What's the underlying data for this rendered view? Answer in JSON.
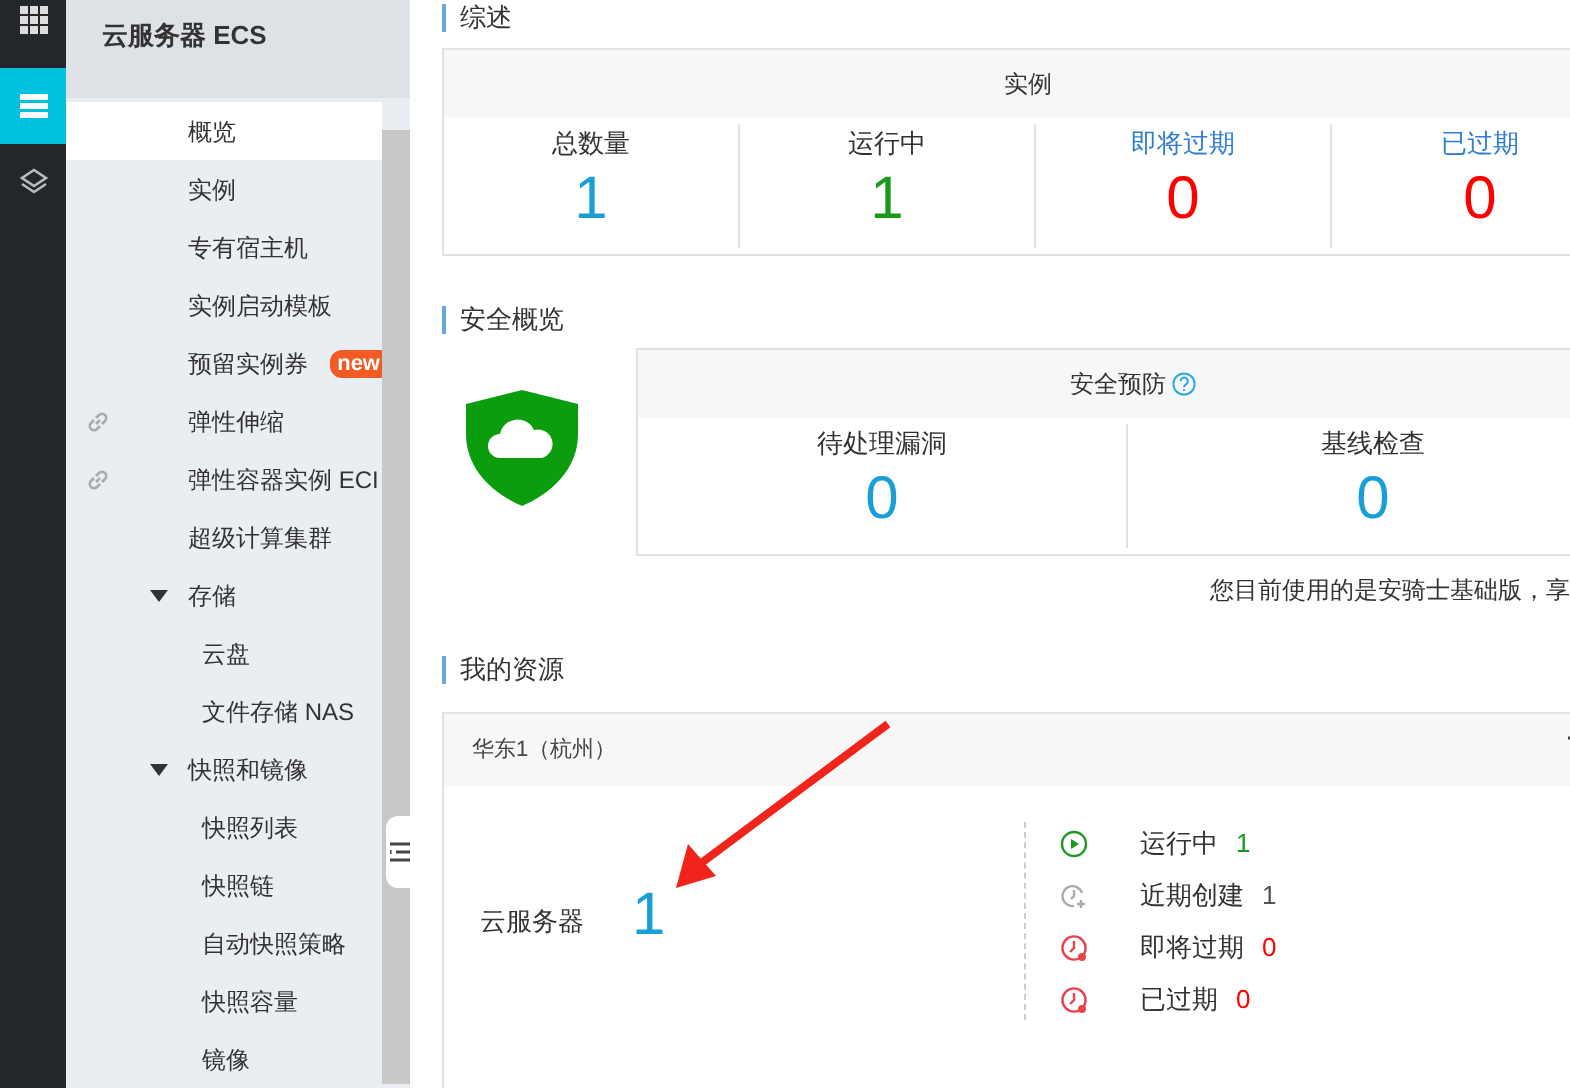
{
  "sidebar": {
    "title": "云服务器 ECS",
    "items": [
      {
        "kind": "item",
        "label": "概览",
        "selected": true
      },
      {
        "kind": "item",
        "label": "实例",
        "selected": false
      },
      {
        "kind": "item",
        "label": "专有宿主机",
        "selected": false
      },
      {
        "kind": "item",
        "label": "实例启动模板",
        "selected": false
      },
      {
        "kind": "item",
        "label": "预留实例券",
        "selected": false,
        "badge": "new"
      },
      {
        "kind": "link",
        "label": "弹性伸缩",
        "selected": false
      },
      {
        "kind": "link",
        "label": "弹性容器实例 ECI",
        "selected": false
      },
      {
        "kind": "item",
        "label": "超级计算集群",
        "selected": false
      },
      {
        "kind": "group",
        "label": "存储",
        "expanded": true,
        "children": [
          {
            "kind": "item",
            "label": "云盘",
            "selected": false
          },
          {
            "kind": "item",
            "label": "文件存储 NAS",
            "selected": false
          }
        ]
      },
      {
        "kind": "group",
        "label": "快照和镜像",
        "expanded": true,
        "children": [
          {
            "kind": "item",
            "label": "快照列表",
            "selected": false
          },
          {
            "kind": "item",
            "label": "快照链",
            "selected": false
          },
          {
            "kind": "item",
            "label": "自动快照策略",
            "selected": false
          },
          {
            "kind": "item",
            "label": "快照容量",
            "selected": false
          },
          {
            "kind": "item",
            "label": "镜像",
            "selected": false
          }
        ]
      }
    ]
  },
  "overview": {
    "title": "综述",
    "header": "实例",
    "stats": [
      {
        "kind": "text",
        "label": "总数量",
        "value": "1",
        "color": "#1a9ed6"
      },
      {
        "kind": "text",
        "label": "运行中",
        "value": "1",
        "color": "#1a9a1a"
      },
      {
        "kind": "link",
        "label": "即将过期",
        "value": "0",
        "color": "#ff0000"
      },
      {
        "kind": "link",
        "label": "已过期",
        "value": "0",
        "color": "#ff0000"
      }
    ]
  },
  "security": {
    "title": "安全概览",
    "header": "安全预防",
    "stats": [
      {
        "label": "待处理漏洞",
        "value": "0"
      },
      {
        "label": "基线检查",
        "value": "0"
      }
    ],
    "note": "您目前使用的是安骑士基础版，享"
  },
  "resources": {
    "title": "我的资源",
    "region": "华东1（杭州）",
    "product": "云服务器",
    "count": "1",
    "statuses": [
      {
        "kind": "running",
        "label": "运行中",
        "value": "1",
        "color": "#1a9a1a"
      },
      {
        "kind": "recent",
        "label": "近期创建",
        "value": "1",
        "color": "#555555"
      },
      {
        "kind": "expiring",
        "label": "即将过期",
        "value": "0",
        "color": "#ff0000"
      },
      {
        "kind": "expired",
        "label": "已过期",
        "value": "0",
        "color": "#ff0000"
      }
    ]
  }
}
